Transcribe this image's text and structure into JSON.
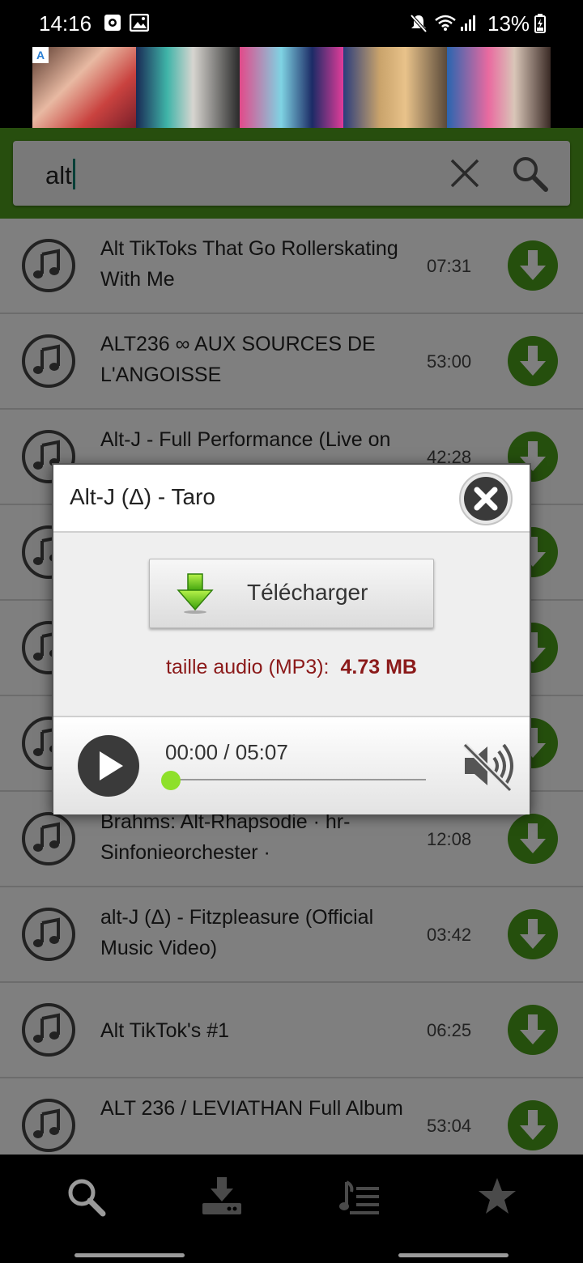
{
  "status_bar": {
    "time": "14:16",
    "battery": "13%",
    "icons": [
      "camera-notification-icon",
      "gallery-notification-icon",
      "mute-icon",
      "wifi-icon",
      "signal-icon",
      "battery-charging-icon"
    ]
  },
  "search": {
    "query": "alt"
  },
  "results": [
    {
      "title": "Alt TikToks That Go Rollerskating With Me",
      "duration": "07:31"
    },
    {
      "title": "ALT236 ∞ AUX SOURCES DE L'ANGOISSE",
      "duration": "53:00"
    },
    {
      "title": "Alt-J - Full Performance (Live on",
      "duration": "42:28"
    },
    {
      "title": "",
      "duration": ""
    },
    {
      "title": "",
      "duration": ""
    },
    {
      "title": "",
      "duration": ""
    },
    {
      "title": "Brahms: Alt-Rhapsodie · hr-Sinfonieorchester ·",
      "duration": "12:08"
    },
    {
      "title": "alt-J (Δ) - Fitzpleasure (Official Music Video)",
      "duration": "03:42"
    },
    {
      "title": "Alt TikTok's #1",
      "duration": "06:25"
    },
    {
      "title": "ALT 236 / LEVIATHAN Full Album",
      "duration": "53:04"
    }
  ],
  "dialog": {
    "title": "Alt-J (Δ) - Taro",
    "download_label": "Télécharger",
    "size_label": "taille audio (MP3):",
    "size_value": "4.73 MB",
    "time_display": "00:00 / 05:07",
    "progress": 0
  },
  "nav": [
    "search-icon",
    "downloads-icon",
    "playlist-icon",
    "favorites-icon"
  ],
  "colors": {
    "accent_green": "#4f9d1c",
    "download_green": "#4a9e1a",
    "size_text": "#8b1a1a"
  }
}
